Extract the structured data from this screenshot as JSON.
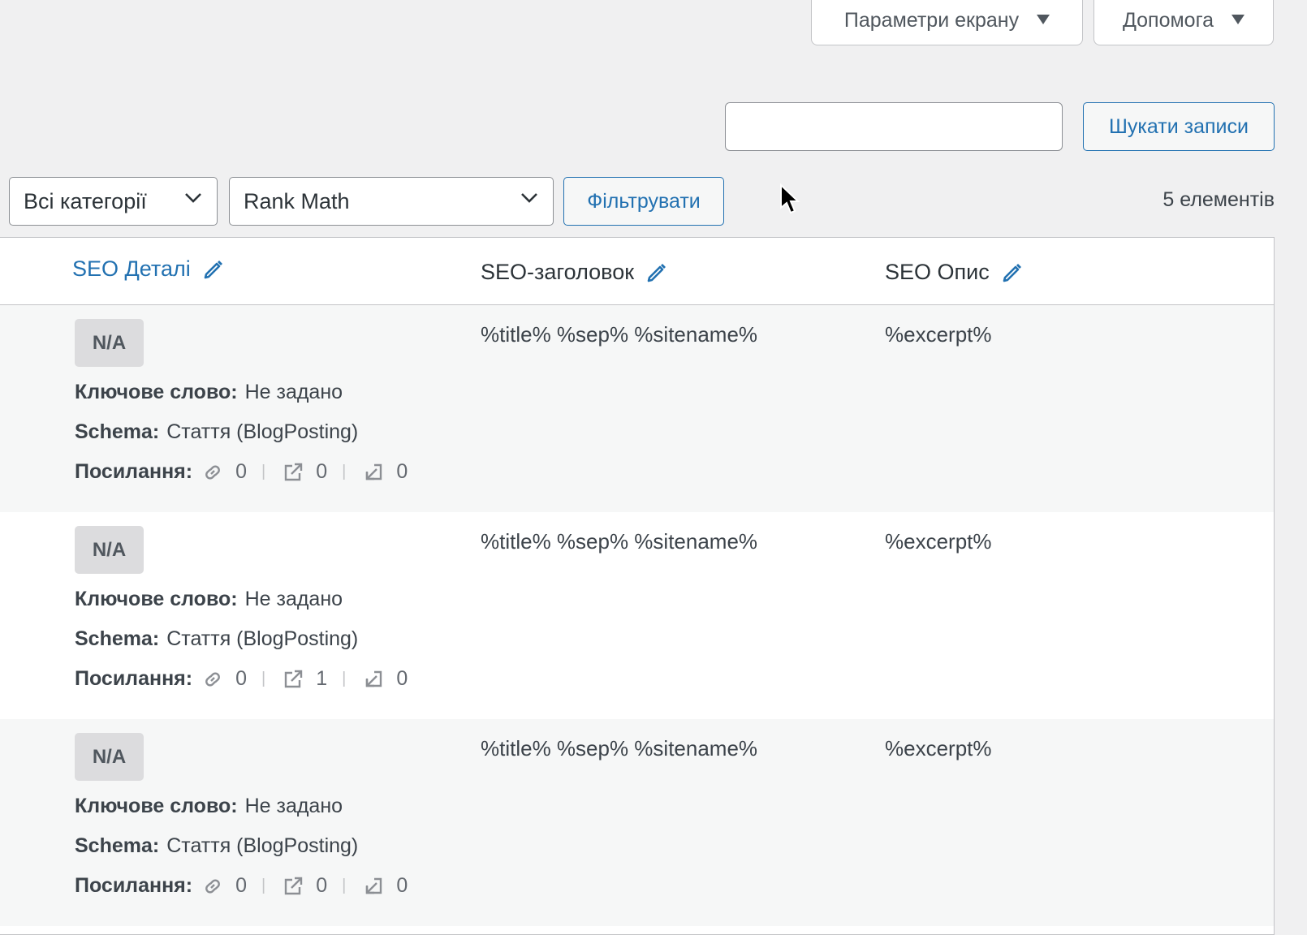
{
  "screen_meta": {
    "screen_options_label": "Параметри екрану",
    "help_label": "Допомога"
  },
  "search": {
    "value": "",
    "button_label": "Шукати записи"
  },
  "filters": {
    "category_selected": "Всі категорії",
    "seo_filter_selected": "Rank Math",
    "filter_button_label": "Фільтрувати",
    "items_count": "5 елементів"
  },
  "table": {
    "headers": {
      "seo_details": "SEO Деталі",
      "seo_title": "SEO-заголовок",
      "seo_description": "SEO Опис"
    },
    "rows": [
      {
        "score": "N/A",
        "keyword_label": "Ключове слово:",
        "keyword_value": "Не задано",
        "schema_label": "Schema:",
        "schema_value": "Стаття (BlogPosting)",
        "links_label": "Посилання:",
        "internal_links": "0",
        "external_links": "0",
        "incoming_links": "0",
        "seo_title": "%title% %sep% %sitename%",
        "seo_description": "%excerpt%"
      },
      {
        "score": "N/A",
        "keyword_label": "Ключове слово:",
        "keyword_value": "Не задано",
        "schema_label": "Schema:",
        "schema_value": "Стаття (BlogPosting)",
        "links_label": "Посилання:",
        "internal_links": "0",
        "external_links": "1",
        "incoming_links": "0",
        "seo_title": "%title% %sep% %sitename%",
        "seo_description": "%excerpt%"
      },
      {
        "score": "N/A",
        "keyword_label": "Ключове слово:",
        "keyword_value": "Не задано",
        "schema_label": "Schema:",
        "schema_value": "Стаття (BlogPosting)",
        "links_label": "Посилання:",
        "internal_links": "0",
        "external_links": "0",
        "incoming_links": "0",
        "seo_title": "%title% %sep% %sitename%",
        "seo_description": "%excerpt%"
      }
    ]
  },
  "colors": {
    "accent": "#2271b1",
    "background": "#f0f0f1",
    "row_alt": "#f6f7f7"
  }
}
